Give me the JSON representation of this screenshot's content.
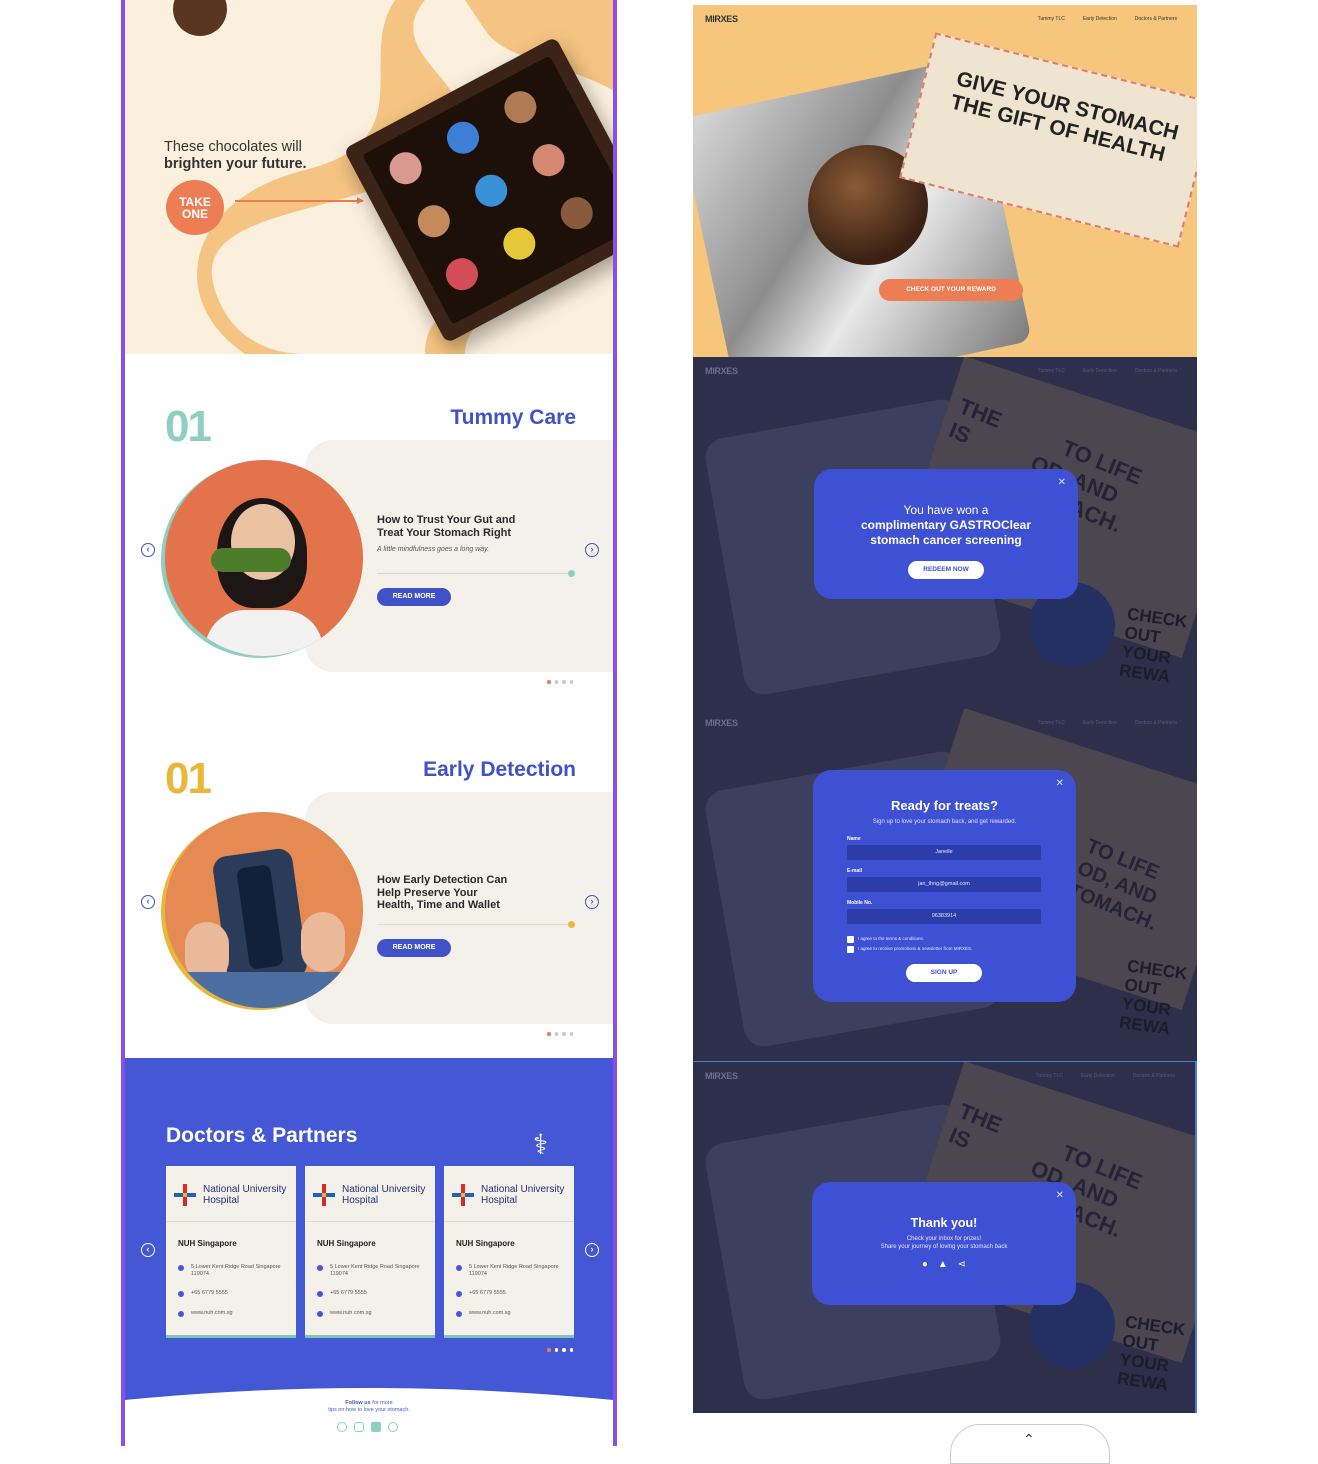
{
  "hero": {
    "tagline_line1": "These chocolates will",
    "tagline_line2": "brighten your future.",
    "cta": "TAKE ONE"
  },
  "tummy": {
    "number": "01",
    "title": "Tummy Care",
    "heading": "How to Trust Your Gut and Treat Your Stomach Right",
    "subtitle": "A little mindfulness goes a long way.",
    "button": "READ MORE"
  },
  "early": {
    "number": "01",
    "title": "Early Detection",
    "heading": "How Early Detection Can Help Preserve Your Health, Time and Wallet",
    "button": "READ MORE"
  },
  "doctors": {
    "title": "Doctors & Partners",
    "cards": [
      {
        "hospital": "National University Hospital",
        "location": "NUH Singapore",
        "address": "5 Lower Kent Ridge Road Singapore 119074",
        "phone": "+65 6779 5555",
        "web": "www.nuh.com.sg"
      },
      {
        "hospital": "National University Hospital",
        "location": "NUH Singapore",
        "address": "5 Lower Kent Ridge Road Singapore 119074",
        "phone": "+65 6779 5555",
        "web": "www.nuh.com.sg"
      },
      {
        "hospital": "National University Hospital",
        "location": "NUH Singapore",
        "address": "5 Lower Kent Ridge Road Singapore 119074",
        "phone": "+65 6779 5555",
        "web": "www.nuh.com.sg"
      }
    ]
  },
  "footer": {
    "follow_bold": "Follow us",
    "follow_rest": "for more",
    "follow_line2": "tips on how to love your stomach."
  },
  "nav": {
    "brand": "MIRXES",
    "links": [
      "Tummy TLC",
      "Early Detection",
      "Doctors & Partners"
    ]
  },
  "panel1": {
    "ticket_line1": "GIVE YOUR STOMACH",
    "ticket_line2": "THE GIFT OF HEALTH",
    "cta": "CHECK OUT YOUR REWARD"
  },
  "bg_ticket": {
    "line1": "THE",
    "line2": "IS",
    "line3": "TO LIFE",
    "line4": "OD, AND",
    "line5": "TOMACH.",
    "check1": "CHECK OUT",
    "check2": "YOUR REWA"
  },
  "modal_won": {
    "line1": "You have won a",
    "line2": "complimentary GASTROClear",
    "line3": "stomach cancer screening",
    "button": "REDEEM NOW"
  },
  "modal_signup": {
    "title": "Ready for treats?",
    "subtitle": "Sign up to love your stomach back, and get rewarded.",
    "name_label": "Name",
    "name_value": "Janelle",
    "email_label": "E-mail",
    "email_value": "jan_thng@gmail.com",
    "mobile_label": "Mobile No.",
    "mobile_value": "96383914",
    "check1": "I agree to the terms & conditions.",
    "check2": "I agree to receive promotions & newsletter from MIRXES.",
    "button": "SIGN UP"
  },
  "modal_thanks": {
    "title": "Thank you!",
    "line1": "Check your inbox for prizes!",
    "line2": "Share your journey of loving your stomach back"
  },
  "colors": {
    "accent": "#3f52c9",
    "orange": "#ec7d54",
    "teal": "#8fcfc1",
    "yellow": "#e9b83a",
    "frame": "#8a4fe6",
    "dark_overlay": "#2e2f4a"
  }
}
